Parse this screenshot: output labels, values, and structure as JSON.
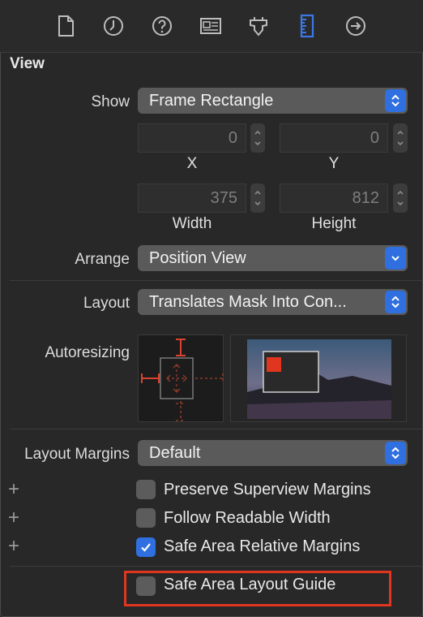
{
  "toolbar": {
    "icons": [
      "file-icon",
      "clock-icon",
      "help-icon",
      "identity-card-icon",
      "attributes-icon",
      "ruler-icon",
      "arrow-right-circle-icon"
    ],
    "selected": "ruler-icon",
    "accent": "#3b78e7"
  },
  "section": {
    "title": "View"
  },
  "show": {
    "label": "Show",
    "value": "Frame Rectangle"
  },
  "frame": {
    "x_value": "0",
    "y_value": "0",
    "x_label": "X",
    "y_label": "Y",
    "width_value": "375",
    "height_value": "812",
    "width_label": "Width",
    "height_label": "Height"
  },
  "arrange": {
    "label": "Arrange",
    "value": "Position View"
  },
  "layout": {
    "label": "Layout",
    "value": "Translates Mask Into Con..."
  },
  "autoresizing": {
    "label": "Autoresizing"
  },
  "margins": {
    "label": "Layout Margins",
    "value": "Default"
  },
  "options": [
    {
      "label": "Preserve Superview Margins",
      "checked": false,
      "plus": "+"
    },
    {
      "label": "Follow Readable Width",
      "checked": false,
      "plus": "+"
    },
    {
      "label": "Safe Area Relative Margins",
      "checked": true,
      "plus": "+"
    },
    {
      "label": "Safe Area Layout Guide",
      "checked": false,
      "plus": ""
    }
  ],
  "colors": {
    "panel_bg": "#282828",
    "popup_bg": "#5a5a5a",
    "accent_blue": "#2f6fe0",
    "highlight_red": "#e0351f",
    "autoresize_red": "#d9432f"
  }
}
